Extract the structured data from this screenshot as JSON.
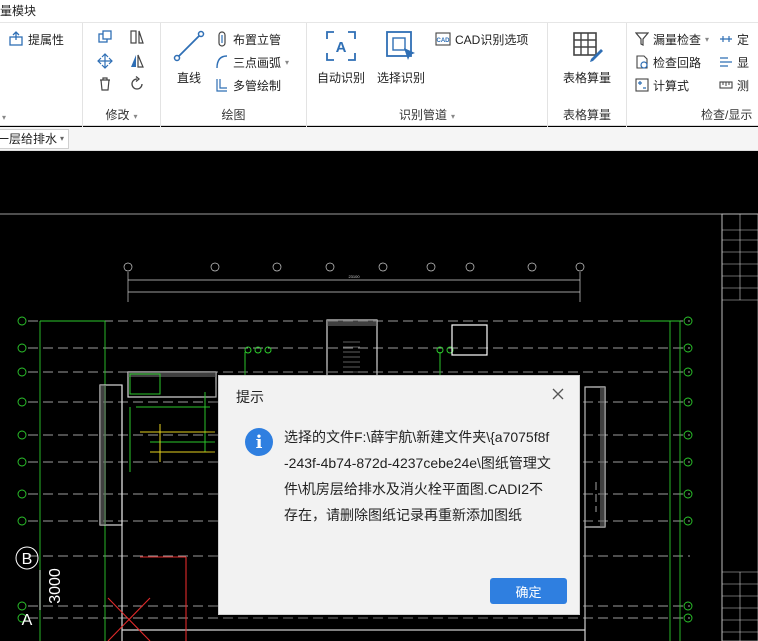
{
  "ribbon": {
    "tab_label": "计量模块",
    "groups": {
      "g1": {
        "items": [
          "提属性"
        ]
      },
      "modify": {
        "title": "修改"
      },
      "draw": {
        "title": "绘图",
        "line_label": "直线",
        "riser_label": "布置立管",
        "arc_label": "三点画弧",
        "multi_pipe_label": "多管绘制"
      },
      "recognize": {
        "title": "识别管道",
        "auto_label": "自动识别",
        "select_label": "选择识别",
        "cad_options_label": "CAD识别选项"
      },
      "table": {
        "title": "表格算量",
        "button_label": "表格算量"
      },
      "check": {
        "title": "检查/显示",
        "leak_check_label": "漏量检查",
        "loop_check_label": "检查回路",
        "formula_label": "计算式",
        "locate_label": "定",
        "display_label": "显",
        "measure_label": "测"
      }
    }
  },
  "toolbar": {
    "floor_select_value": "一层给排水"
  },
  "drawing": {
    "axis_labels": [
      "B",
      "A"
    ],
    "dimension_label": "3000",
    "top_dimension_label": "23100"
  },
  "dialog": {
    "title": "提示",
    "message": "选择的文件F:\\薛宇航\\新建文件夹\\{a7075f8f-243f-4b74-872d-4237cebe24e\\图纸管理文件\\机房层给排水及消火栓平面图.CADI2不存在，请删除图纸记录再重新添加图纸",
    "ok_label": "确定"
  }
}
